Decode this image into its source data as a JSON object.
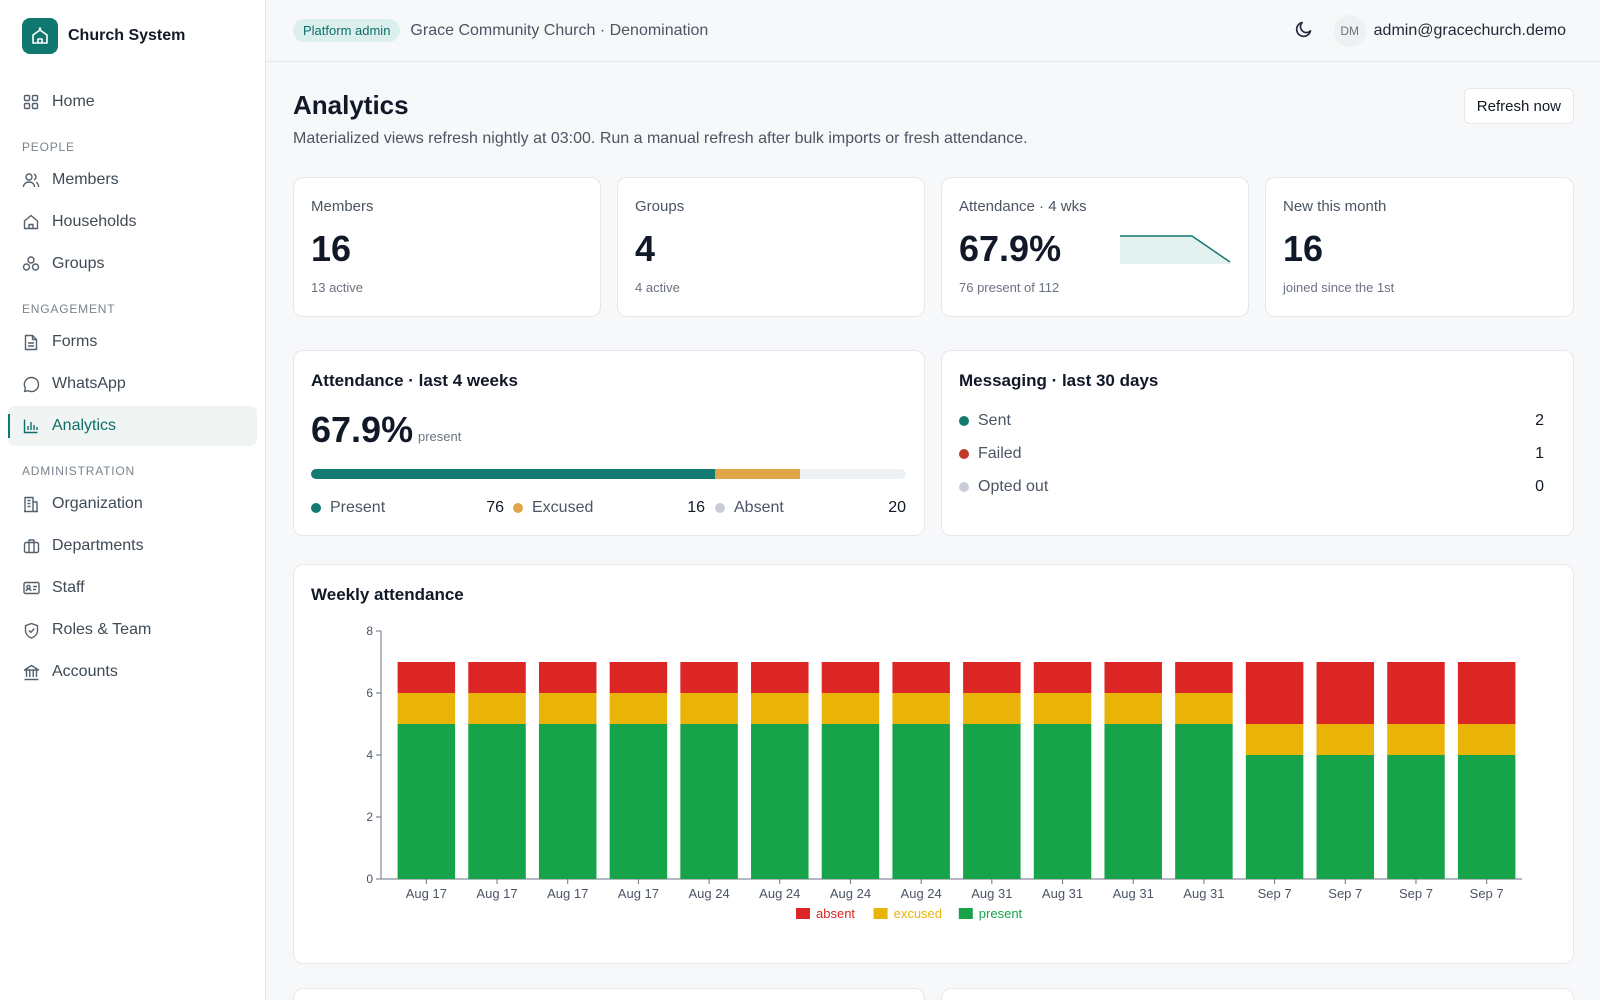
{
  "app": {
    "name": "Church System"
  },
  "sidebar": {
    "items": [
      {
        "label": "Home"
      },
      {
        "label": "Members"
      },
      {
        "label": "Households"
      },
      {
        "label": "Groups"
      },
      {
        "label": "Forms"
      },
      {
        "label": "WhatsApp"
      },
      {
        "label": "Analytics",
        "active": true
      },
      {
        "label": "Organization"
      },
      {
        "label": "Departments"
      },
      {
        "label": "Staff"
      },
      {
        "label": "Roles & Team"
      },
      {
        "label": "Accounts"
      }
    ],
    "sections": {
      "people": "PEOPLE",
      "engagement": "ENGAGEMENT",
      "administration": "ADMINISTRATION"
    }
  },
  "topbar": {
    "badge": "Platform admin",
    "org": "Grace Community Church · Denomination",
    "avatar_initials": "DM",
    "user_email": "admin@gracechurch.demo"
  },
  "page": {
    "title": "Analytics",
    "subtitle": "Materialized views refresh nightly at 03:00. Run a manual refresh after bulk imports or fresh attendance.",
    "refresh_label": "Refresh now"
  },
  "stats": [
    {
      "label": "Members",
      "value": "16",
      "sub": "13 active"
    },
    {
      "label": "Groups",
      "value": "4",
      "sub": "4 active"
    },
    {
      "label": "Attendance · 4 wks",
      "value": "67.9%",
      "sub": "76 present of 112"
    },
    {
      "label": "New this month",
      "value": "16",
      "sub": "joined since the 1st"
    }
  ],
  "attendance_card": {
    "title": "Attendance · last 4 weeks",
    "pct": "67.9%",
    "pct_sub": "present",
    "breakdown": [
      {
        "label": "Present",
        "value": 76,
        "color": "#137a72"
      },
      {
        "label": "Excused",
        "value": 16,
        "color": "#e0a548"
      },
      {
        "label": "Absent",
        "value": 20,
        "color": "#c9ced6"
      }
    ],
    "total": 112
  },
  "messaging_card": {
    "title": "Messaging · last 30 days",
    "rows": [
      {
        "label": "Sent",
        "value": "2",
        "color": "#137a72"
      },
      {
        "label": "Failed",
        "value": "1",
        "color": "#c0392b"
      },
      {
        "label": "Opted out",
        "value": "0",
        "color": "#c9ced6"
      }
    ]
  },
  "colors": {
    "accent": "#10776f",
    "absent": "#dc2626",
    "excused": "#eab308",
    "present": "#16a34a"
  },
  "chart_data": {
    "type": "bar",
    "stacked": true,
    "title": "Weekly attendance",
    "categories": [
      "Aug 17",
      "Aug 17",
      "Aug 17",
      "Aug 17",
      "Aug 24",
      "Aug 24",
      "Aug 24",
      "Aug 24",
      "Aug 31",
      "Aug 31",
      "Aug 31",
      "Aug 31",
      "Sep 7",
      "Sep 7",
      "Sep 7",
      "Sep 7"
    ],
    "series": [
      {
        "name": "present",
        "color": "#16a34a",
        "values": [
          5,
          5,
          5,
          5,
          5,
          5,
          5,
          5,
          5,
          5,
          5,
          5,
          4,
          4,
          4,
          4
        ]
      },
      {
        "name": "excused",
        "color": "#eab308",
        "values": [
          1,
          1,
          1,
          1,
          1,
          1,
          1,
          1,
          1,
          1,
          1,
          1,
          1,
          1,
          1,
          1
        ]
      },
      {
        "name": "absent",
        "color": "#dc2626",
        "values": [
          1,
          1,
          1,
          1,
          1,
          1,
          1,
          1,
          1,
          1,
          1,
          1,
          2,
          2,
          2,
          2
        ]
      }
    ],
    "legend_order": [
      "absent",
      "excused",
      "present"
    ],
    "ylim": [
      0,
      8
    ],
    "yticks": [
      0,
      2,
      4,
      6,
      8
    ],
    "grid": false,
    "legend_position": "bottom"
  }
}
